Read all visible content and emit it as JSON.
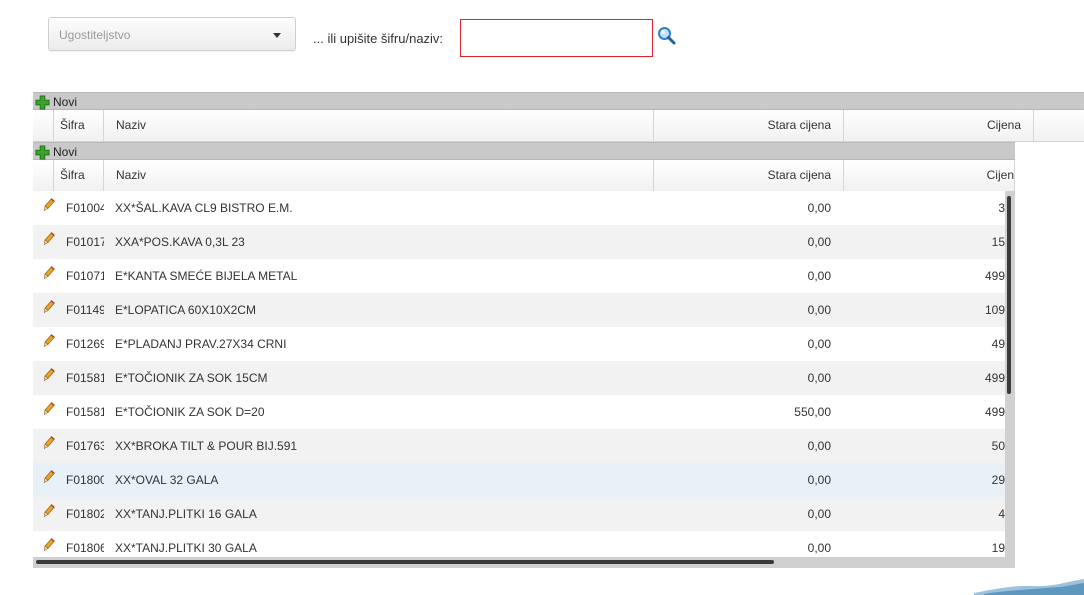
{
  "filter": {
    "category_select": "Ugostiteljstvo",
    "or_label": "... ili upišite šifru/naziv:",
    "code_value": ""
  },
  "toolbar": {
    "new_label": "Novi"
  },
  "columns": {
    "code": "Šifra",
    "name": "Naziv",
    "old_price": "Stara cijena",
    "price": "Cijena",
    "price_clipped": "Cijen"
  },
  "rows": [
    {
      "code": "F01004",
      "name": "XX*ŠAL.KAVA CL9 BISTRO E.M.",
      "old_price": "0,00",
      "price": "3"
    },
    {
      "code": "F01017",
      "name": "XXA*POS.KAVA 0,3L 23",
      "old_price": "0,00",
      "price": "15"
    },
    {
      "code": "F01071",
      "name": "E*KANTA SMEĆE BIJELA METAL",
      "old_price": "0,00",
      "price": "499"
    },
    {
      "code": "F01149",
      "name": "E*LOPATICA 60X10X2CM",
      "old_price": "0,00",
      "price": "109"
    },
    {
      "code": "F01269",
      "name": "E*PLADANJ PRAV.27X34 CRNI",
      "old_price": "0,00",
      "price": "49"
    },
    {
      "code": "F01581",
      "name": "E*TOČIONIK ZA SOK 15CM",
      "old_price": "0,00",
      "price": "499"
    },
    {
      "code": "F01581",
      "name": "E*TOČIONIK ZA SOK D=20",
      "old_price": "550,00",
      "price": "499"
    },
    {
      "code": "F01763",
      "name": "XX*BROKA TILT & POUR BIJ.591",
      "old_price": "0,00",
      "price": "50"
    },
    {
      "code": "F01800",
      "name": "XX*OVAL 32 GALA",
      "old_price": "0,00",
      "price": "29"
    },
    {
      "code": "F01802",
      "name": "XX*TANJ.PLITKI 16 GALA",
      "old_price": "0,00",
      "price": "4"
    },
    {
      "code": "F01806",
      "name": "XX*TANJ.PLITKI 30 GALA",
      "old_price": "0,00",
      "price": "19"
    }
  ],
  "colors": {
    "accent_red": "#e0222a",
    "add_green": "#3aa52b",
    "selected_row": "#e8f0f8"
  }
}
